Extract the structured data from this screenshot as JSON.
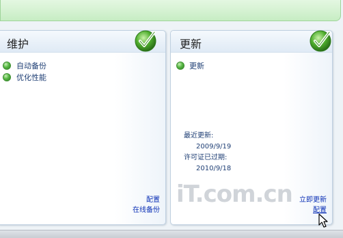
{
  "maintenance": {
    "title": "维护",
    "items": [
      {
        "label": "自动备份"
      },
      {
        "label": "优化性能"
      }
    ],
    "links": [
      "配置",
      "在线备份"
    ]
  },
  "update": {
    "title": "更新",
    "items": [
      {
        "label": "更新"
      }
    ],
    "last_update_label": "最近更新:",
    "last_update_date": "2009/9/19",
    "license_label": "许可证已过期:",
    "license_date": "2010/9/18",
    "links": [
      "立即更新",
      "配置"
    ]
  },
  "watermark": "iT.com.cn",
  "colors": {
    "accent_green": "#58b845",
    "link_blue": "#0a2fb5",
    "text_navy": "#1e3e74"
  },
  "icons": [
    "check-badge-icon",
    "status-ok-icon",
    "mouse-pointer-icon"
  ]
}
